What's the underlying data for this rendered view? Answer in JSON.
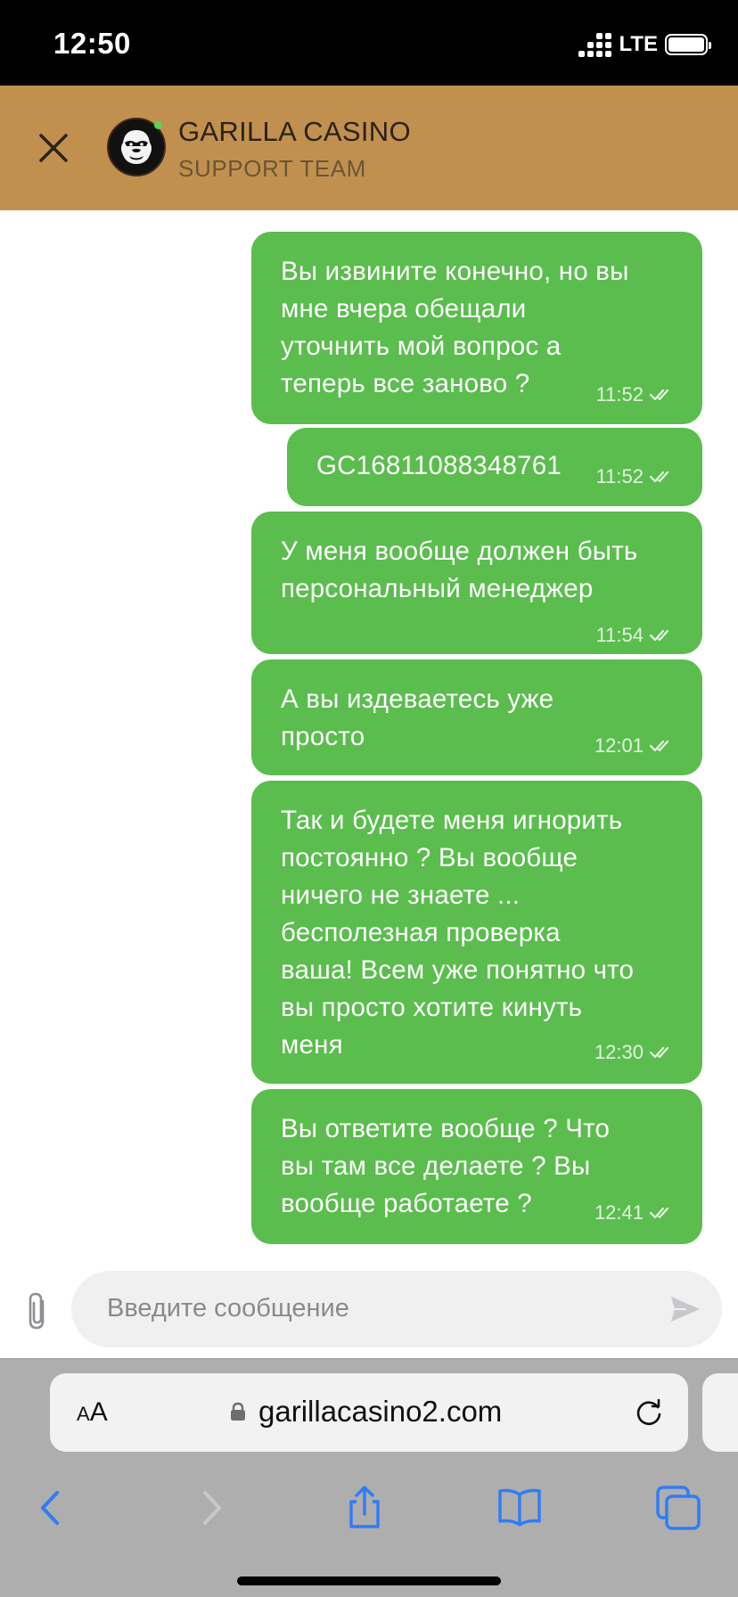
{
  "status_bar": {
    "time": "12:50",
    "network": "LTE"
  },
  "header": {
    "title": "GARILLA CASINO",
    "subtitle": "SUPPORT TEAM"
  },
  "messages": [
    {
      "text": "Вы извините конечно, но вы\nмне вчера обещали\nуточнить мой вопрос а\nтеперь все заново ?",
      "time": "11:52"
    },
    {
      "text": "GC16811088348761",
      "time": "11:52"
    },
    {
      "text": "У меня вообще должен быть\nперсональный менеджер",
      "time": "11:54"
    },
    {
      "text": "А вы издеваетесь уже\nпросто",
      "time": "12:01"
    },
    {
      "text": "Так и будете меня игнорить\nпостоянно ? Вы вообще\nничего не знаете ...\nбесполезная проверка\nваша! Всем уже понятно что\nвы просто хотите кинуть\nменя",
      "time": "12:30"
    },
    {
      "text": "Вы ответите вообще ? Что\nвы там все делаете ? Вы\nвообще работаете ?",
      "time": "12:41"
    }
  ],
  "composer": {
    "placeholder": "Введите сообщение"
  },
  "browser": {
    "text_size_label_small": "A",
    "text_size_label_large": "A",
    "url": "garillacasino2.com"
  },
  "colors": {
    "header_bg": "#c1904f",
    "bubble_bg": "#5bbd4e",
    "browser_blue": "#2f7cf6"
  }
}
